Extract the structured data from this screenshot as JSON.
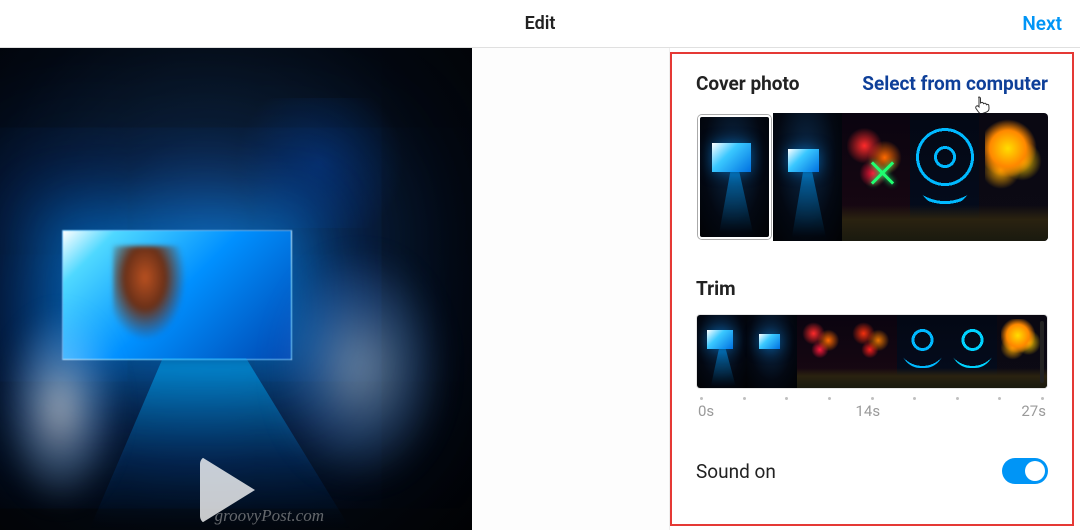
{
  "header": {
    "title": "Edit",
    "next": "Next"
  },
  "watermark": "groovyPost.com",
  "panel": {
    "cover": {
      "title": "Cover photo",
      "select": "Select from computer"
    },
    "trim": {
      "title": "Trim",
      "start": "0s",
      "mid": "14s",
      "end": "27s"
    },
    "sound": {
      "label": "Sound on",
      "on": true
    }
  }
}
